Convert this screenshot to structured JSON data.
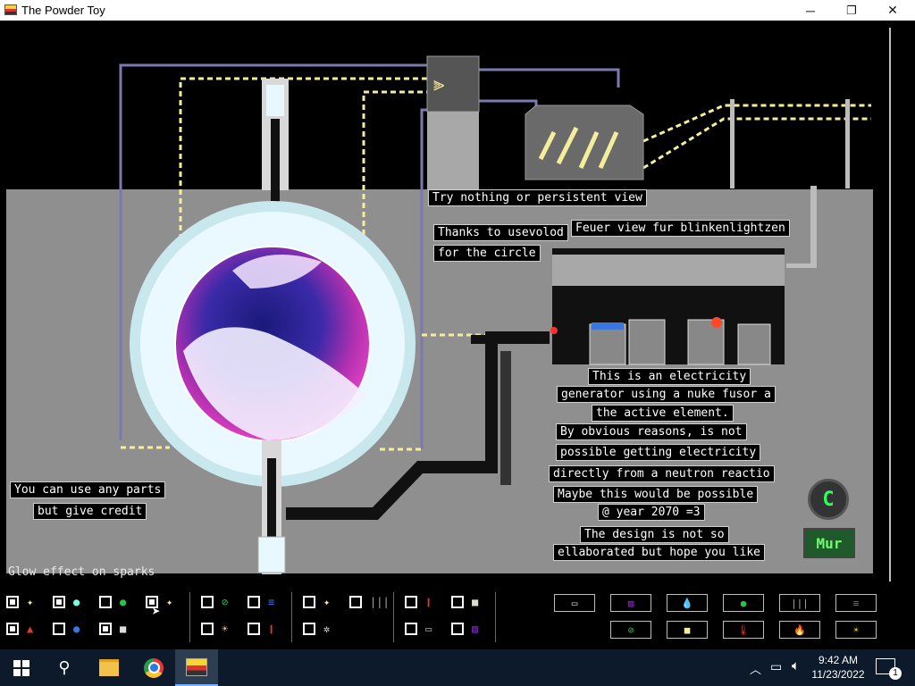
{
  "window": {
    "title": "The Powder Toy",
    "controls": {
      "minimize": "─",
      "maximize": "❐",
      "close": "✕"
    }
  },
  "simulation": {
    "signs": [
      "Try nothing or persistent view",
      "Thanks to usevolod",
      "for the circle",
      "Feuer view fur blinkenlightzen",
      "This is an electricity",
      "generator using a nuke fusor a",
      "the active element.",
      "By obvious reasons, is not",
      "possible getting electricity",
      "directly from a neutron reactio",
      "Maybe this would be possible",
      "@ year 2070 =3",
      "The design is not so",
      "ellaborated but hope you like",
      "You can use any parts",
      "but give credit"
    ],
    "glow_note": "Glow effect on sparks",
    "logo_c": "C",
    "logo_mur": "Mur"
  },
  "toolbar": {
    "left_icons": [
      "spark-icon",
      "cloud-icon",
      "green-blob-icon",
      "star-icon",
      "wall-circle-icon",
      "lines-icon",
      "sun-icon",
      "bars-icon",
      "thermometer-icon",
      "square-icon",
      "fire-icon",
      "drop-icon",
      "dot-icon",
      "fan-icon",
      "heater-icon",
      "powder-icon",
      "striped-icon"
    ],
    "right_buttons": [
      {
        "icon": "gallery-icon",
        "glyph": "▭"
      },
      {
        "icon": "striped-icon",
        "glyph": "▨"
      },
      {
        "icon": "drop-icon",
        "glyph": "💧"
      },
      {
        "icon": "green-blob-icon",
        "glyph": "●"
      },
      {
        "icon": "bars-icon",
        "glyph": "|||"
      },
      {
        "icon": "lines-icon",
        "glyph": "≡"
      },
      {
        "icon": "wall-circle-icon",
        "glyph": "⊘"
      },
      {
        "icon": "square-icon",
        "glyph": "■"
      },
      {
        "icon": "thermometer-icon",
        "glyph": "🌡"
      },
      {
        "icon": "fire-icon",
        "glyph": "🔥"
      },
      {
        "icon": "sun-icon",
        "glyph": "☀"
      }
    ],
    "colors": {
      "accent": "#f4ee9c",
      "green": "#27c44a",
      "purple": "#8a2bd0",
      "blue": "#3a78e0",
      "red": "#e03a20"
    }
  },
  "taskbar": {
    "time": "9:42 AM",
    "date": "11/23/2022",
    "notifications": "1"
  }
}
